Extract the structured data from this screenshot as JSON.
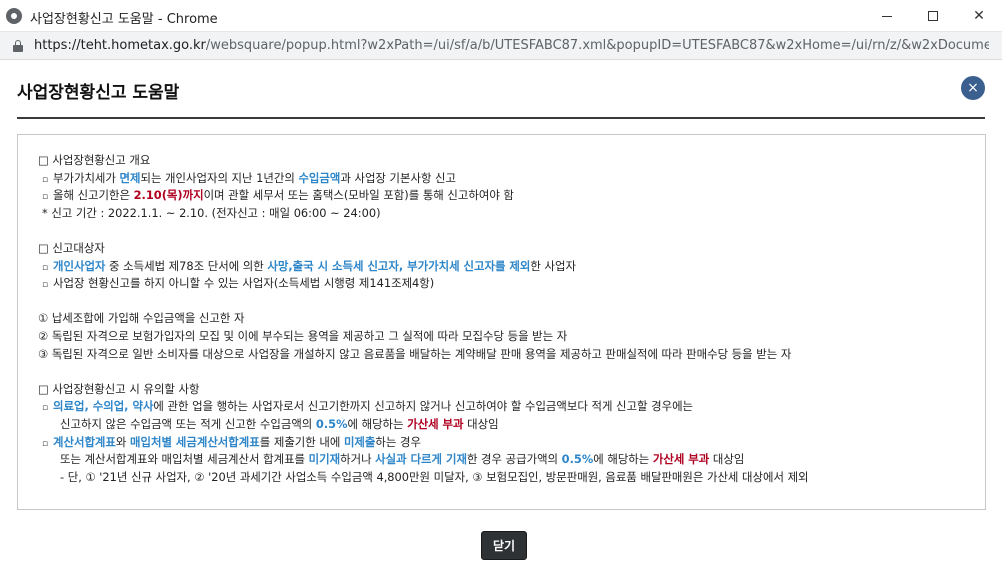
{
  "window": {
    "title": "사업장현황신고 도움말 - Chrome",
    "url_domain": "https://teht.hometax.go.kr",
    "url_rest": "/websquare/popup.html?w2xPath=/ui/sf/a/b/UTESFABC87.xml&popupID=UTESFABC87&w2xHome=/ui/rn/z/&w2xDocume..."
  },
  "popup": {
    "title": "사업장현황신고 도움말",
    "close_glyph": "×",
    "close_button_label": "닫기"
  },
  "sections": {
    "s1": {
      "heading": "□ 사업장현황신고 개요",
      "l1": [
        "부가가치세가 ",
        "면제",
        "되는 개인사업자의 지난 1년간의 ",
        "수입금액",
        "과 사업장 기본사항 신고"
      ],
      "l2": [
        "올해 신고기한은 ",
        "2.10(목)까지",
        "이며 관할 세무서 또는 홈택스(모바일 포함)를 통해 신고하여야 함"
      ],
      "l3": "* 신고 기간 : 2022.1.1. ~ 2.10. (전자신고 : 매일 06:00 ~ 24:00)"
    },
    "s2": {
      "heading": "□ 신고대상자",
      "l1": [
        "개인사업자",
        " 중 소득세법 제78조 단서에 의한 ",
        "사망,출국 시 소득세 신고자, 부가가치세 신고자를 제외",
        "한 사업자"
      ],
      "l2": "사업장 현황신고를 하지 아니할 수 있는 사업자(소득세법 시행령 제141조제4항)",
      "n1": "① 납세조합에 가입해 수입금액을 신고한 자",
      "n2": "② 독립된 자격으로 보험가입자의 모집 및 이에 부수되는 용역을 제공하고 그 실적에 따라 모집수당 등을 받는 자",
      "n3": "③ 독립된 자격으로 일반 소비자를 대상으로 사업장을 개설하지 않고 음료품을 배달하는 계약배달 판매 용역을 제공하고 판매실적에 따라 판매수당 등을 받는 자"
    },
    "s3": {
      "heading": "□ 사업장현황신고 시 유의할 사항",
      "l1": [
        "의료업, 수의업, 약사",
        "에 관한 업을 행하는 사업자로서 신고기한까지 신고하지 않거나 신고하여야 할 수입금액보다 적게 신고할 경우에는"
      ],
      "l1b": [
        "신고하지 않은 수입금액 또는 적게 신고한 수입금액의 ",
        "0.5%",
        "에 해당하는 ",
        "가산세 부과",
        " 대상임"
      ],
      "l2": [
        "계산서합계표",
        "와 ",
        "매입처별 세금계산서합계표",
        "를 제출기한 내에 ",
        "미제출",
        "하는 경우"
      ],
      "l2b": [
        "또는 계산서합계표와 매입처별 세금계산서 합계표를 ",
        "미기재",
        "하거나 ",
        "사실과 다르게 기재",
        "한 경우 공급가액의 ",
        "0.5%",
        "에 해당하는 ",
        "가산세 부과",
        "  대상임"
      ],
      "l2c": "- 단, ① '21년 신규 사업자, ② '20년 과세기간 사업소득 수입금액 4,800만원 미달자, ③ 보험모집인, 방문판매원, 음료품 배달판매원은 가산세 대상에서 제외"
    },
    "bullet": "▫"
  }
}
